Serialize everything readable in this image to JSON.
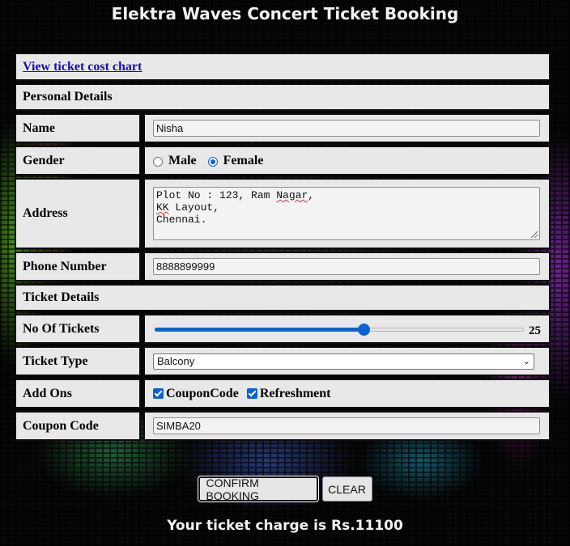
{
  "page": {
    "title": "Elektra Waves Concert Ticket Booking"
  },
  "form": {
    "cost_chart_link": "View ticket cost chart",
    "personal_section": "Personal Details",
    "name": {
      "label": "Name",
      "value": "Nisha"
    },
    "gender": {
      "label": "Gender",
      "options": [
        "Male",
        "Female"
      ],
      "selected": "Female"
    },
    "address": {
      "label": "Address",
      "line1_prefix": "Plot No : 123, Ram ",
      "line1_word": "Nagar",
      "line1_suffix": ",",
      "line2_word": "KK",
      "line2_suffix": " Layout,",
      "line3": "Chennai."
    },
    "phone": {
      "label": "Phone Number",
      "value": "8888899999"
    },
    "ticket_section": "Ticket Details",
    "tickets": {
      "label": "No Of Tickets",
      "value": "25",
      "fraction": 0.565
    },
    "ticket_type": {
      "label": "Ticket Type",
      "value": "Balcony"
    },
    "addons": {
      "label": "Add Ons",
      "options": [
        "CouponCode",
        "Refreshment"
      ],
      "checked": [
        true,
        true
      ]
    },
    "coupon": {
      "label": "Coupon Code",
      "value": "SIMBA20"
    }
  },
  "buttons": {
    "confirm": "CONFIRM BOOKING",
    "clear": "CLEAR"
  },
  "result": {
    "text": "Your ticket charge is Rs.11100"
  },
  "colors": {
    "accent": "#0b62d3",
    "cell_bg": "#e8e8e8",
    "link": "#1a0dab"
  }
}
